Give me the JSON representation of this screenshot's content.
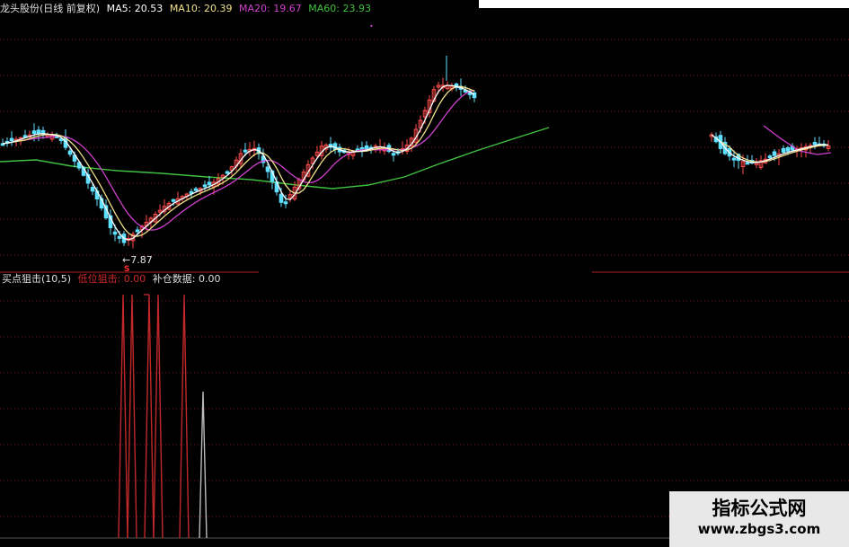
{
  "header": {
    "title": "龙头股份(日线 前复权)",
    "ma5": "MA5: 20.53",
    "ma10": "MA10: 20.39",
    "ma20": "MA20: 19.67",
    "ma60": "MA60: 23.93"
  },
  "indicator_header": {
    "name": "买点狙击(10,5)",
    "low_label": "低位狙击: 0.00",
    "rebuy_label": "补仓数据: 0.00"
  },
  "low_price_label": "←7.87",
  "signal_marker": "S",
  "watermark": {
    "title": "指标公式网",
    "url": "www.zbgs3.com"
  },
  "colors": {
    "up": "#ff4d4d",
    "down": "#5fe0ff",
    "ma5": "#ffffff",
    "ma10": "#f0e08a",
    "ma20": "#d040d0",
    "ma60": "#40c040",
    "grid": "#7a1a1a",
    "low_signal": "#c0282a",
    "rebuy_signal": "#bbbbbb"
  },
  "chart_data": [
    {
      "type": "candlestick",
      "title": "龙头股份(日线 前复权)",
      "series": [
        {
          "name": "MA5",
          "last": 20.53
        },
        {
          "name": "MA10",
          "last": 20.39
        },
        {
          "name": "MA20",
          "last": 19.67
        },
        {
          "name": "MA60",
          "last": 23.93
        }
      ],
      "annotations": [
        "←7.87"
      ],
      "grid": true
    },
    {
      "type": "line",
      "title": "买点狙击(10,5)",
      "series": [
        {
          "name": "低位狙击",
          "last": 0.0
        },
        {
          "name": "补仓数据",
          "last": 0.0
        }
      ],
      "grid": true
    }
  ]
}
